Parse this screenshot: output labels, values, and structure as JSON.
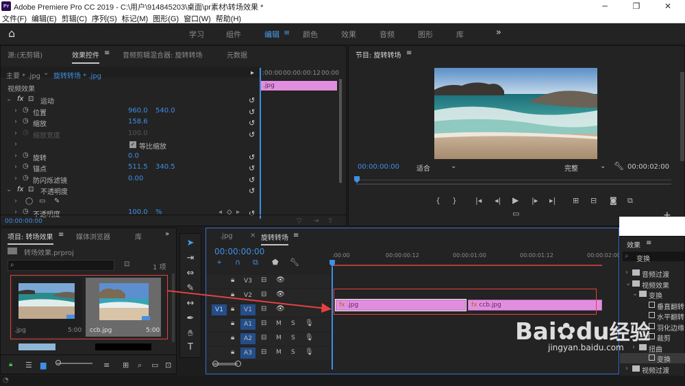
{
  "app": {
    "logo": "Pr",
    "title": "Adobe Premiere Pro CC 2019 - C:\\用户\\914845203\\桌面\\pr素材\\转场效果 *",
    "minimize": "─",
    "maximize": "❐",
    "close": "✕"
  },
  "menu": [
    "文件(F)",
    "编辑(E)",
    "剪辑(C)",
    "序列(S)",
    "标记(M)",
    "图形(G)",
    "窗口(W)",
    "帮助(H)"
  ],
  "workspaces": {
    "home": "⌂",
    "items": [
      "学习",
      "组件",
      "编辑",
      "颜色",
      "效果",
      "音频",
      "图形",
      "库"
    ],
    "active": "编辑",
    "menu_icon": "≡",
    "more": "»"
  },
  "source_panel": {
    "tabs": [
      "源:(无剪辑)",
      "效果控件",
      "音频剪辑混合器: 旋转转场",
      "元数据"
    ],
    "active": "效果控件",
    "menu_icon": "≡",
    "master": "主要 * .jpg",
    "clip": "旋转转场 * .jpg",
    "times": [
      ":00:00",
      "00:00:00:12",
      "00:00"
    ],
    "clip_bar": ".jpg",
    "section": "视频效果",
    "rows": [
      {
        "fx": "fx",
        "label": "运动",
        "v1": "",
        "v2": ""
      },
      {
        "label": "位置",
        "v1": "960.0",
        "v2": "540.0"
      },
      {
        "label": "缩放",
        "v1": "158.6",
        "v2": ""
      },
      {
        "label": "缩放宽度",
        "v1": "100.0",
        "v2": "",
        "disabled": true
      },
      {
        "label": "等比缩放",
        "v1": "",
        "v2": "",
        "checkbox": true
      },
      {
        "label": "旋转",
        "v1": "0.0",
        "v2": ""
      },
      {
        "label": "锚点",
        "v1": "511.5",
        "v2": "340.5"
      },
      {
        "label": "防闪烁滤镜",
        "v1": "0.00",
        "v2": ""
      },
      {
        "fx": "fx",
        "label": "不透明度",
        "v1": "",
        "v2": ""
      },
      {
        "label": "",
        "v1": "",
        "v2": "",
        "masks": true
      },
      {
        "label": "不透明度",
        "v1": "100.0",
        "v2": "%"
      }
    ],
    "timecode": "00:00:00:00"
  },
  "program": {
    "title": "节目: 旋转转场",
    "menu_icon": "≡",
    "timecode": "00:00:00:00",
    "fit": "适合",
    "quality": "完整",
    "duration": "00:00:02:00"
  },
  "project": {
    "tabs": [
      "项目: 转场效果",
      "媒体浏览器",
      "库"
    ],
    "menu_icon": "≡",
    "more": "»",
    "file": "转场效果.prproj",
    "count": "1 项",
    "items": [
      {
        "name": ".jpg",
        "dur": "5:00"
      },
      {
        "name": "ccb.jpg",
        "dur": "5:00"
      }
    ]
  },
  "timeline": {
    "tab_close": "×",
    "tabs": [
      ".jpg",
      "旋转转场"
    ],
    "menu_icon": "≡",
    "timecode": "00:00:00:00",
    "ruler": [
      ":00:00",
      "00:00:00:12",
      "00:00:01:00",
      "00:00:01:12",
      "00:00:02:00"
    ],
    "tracks": [
      {
        "name": "V3",
        "src": "",
        "m": "",
        "s": ""
      },
      {
        "name": "V2",
        "src": "",
        "m": "",
        "s": ""
      },
      {
        "name": "V1",
        "src": "V1",
        "m": "",
        "s": ""
      },
      {
        "name": "A1",
        "src": "",
        "m": "M",
        "s": "S"
      },
      {
        "name": "A2",
        "src": "",
        "m": "M",
        "s": "S"
      },
      {
        "name": "A3",
        "src": "",
        "m": "M",
        "s": "S"
      }
    ],
    "clips": [
      {
        "label": ".jpg",
        "fx": "fx"
      },
      {
        "label": "ccb.jpg",
        "fx": "fx"
      }
    ]
  },
  "effects": {
    "title": "效果",
    "menu_icon": "≡",
    "search": "变换",
    "tree": [
      {
        "label": "音频过渡",
        "level": 0,
        "folder": true
      },
      {
        "label": "视频效果",
        "level": 0,
        "folder": true
      },
      {
        "label": "变换",
        "level": 1,
        "folder": true
      },
      {
        "label": "垂直翻转",
        "level": 2
      },
      {
        "label": "水平翻转",
        "level": 2
      },
      {
        "label": "羽化边缘",
        "level": 2
      },
      {
        "label": "裁剪",
        "level": 2
      },
      {
        "label": "扭曲",
        "level": 1,
        "folder": true
      },
      {
        "label": "变换",
        "level": 2,
        "selected": true
      },
      {
        "label": "视频过渡",
        "level": 0,
        "folder": true
      }
    ]
  },
  "watermark": {
    "brand": "Bai",
    "brand2": "du",
    "suffix": "经验",
    "url": "jingyan.baidu.com"
  }
}
